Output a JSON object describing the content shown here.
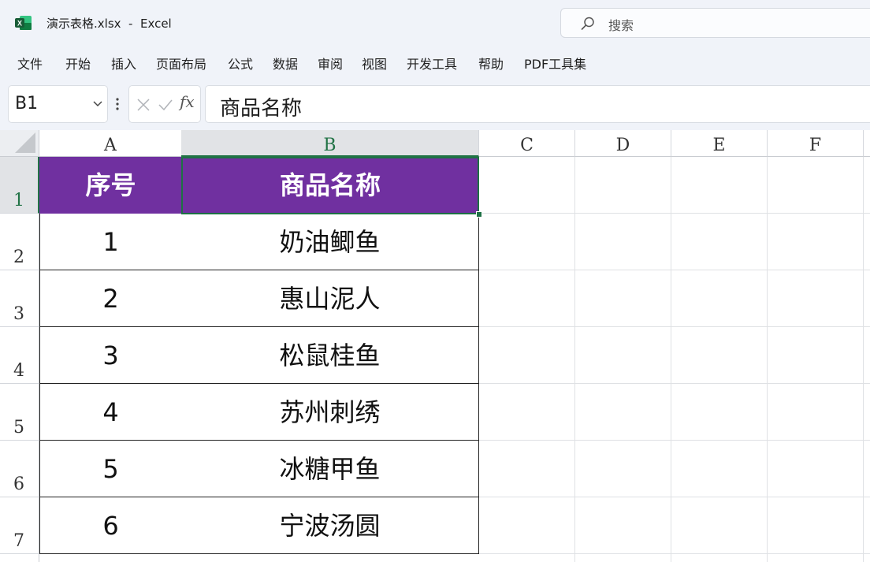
{
  "window": {
    "title": "演示表格.xlsx  -  Excel",
    "search_placeholder": "搜索",
    "app_icon_letter": "X",
    "accent": "#217346"
  },
  "menu": [
    "文件",
    "开始",
    "插入",
    "页面布局",
    "公式",
    "数据",
    "审阅",
    "视图",
    "开发工具",
    "帮助",
    "PDF工具集"
  ],
  "formula_bar": {
    "name_box": "B1",
    "fx_label": "fx",
    "content": "商品名称"
  },
  "grid": {
    "columns": [
      "A",
      "B",
      "C",
      "D",
      "E",
      "F"
    ],
    "rows": [
      "1",
      "2",
      "3",
      "4",
      "5",
      "6",
      "7"
    ],
    "active_cell": "B1",
    "header_fill": "#7030a0",
    "table": {
      "headers": [
        "序号",
        "商品名称"
      ],
      "rows": [
        [
          "1",
          "奶油鲫鱼"
        ],
        [
          "2",
          "惠山泥人"
        ],
        [
          "3",
          "松鼠桂鱼"
        ],
        [
          "4",
          "苏州刺绣"
        ],
        [
          "5",
          "冰糖甲鱼"
        ],
        [
          "6",
          "宁波汤圆"
        ]
      ]
    }
  }
}
